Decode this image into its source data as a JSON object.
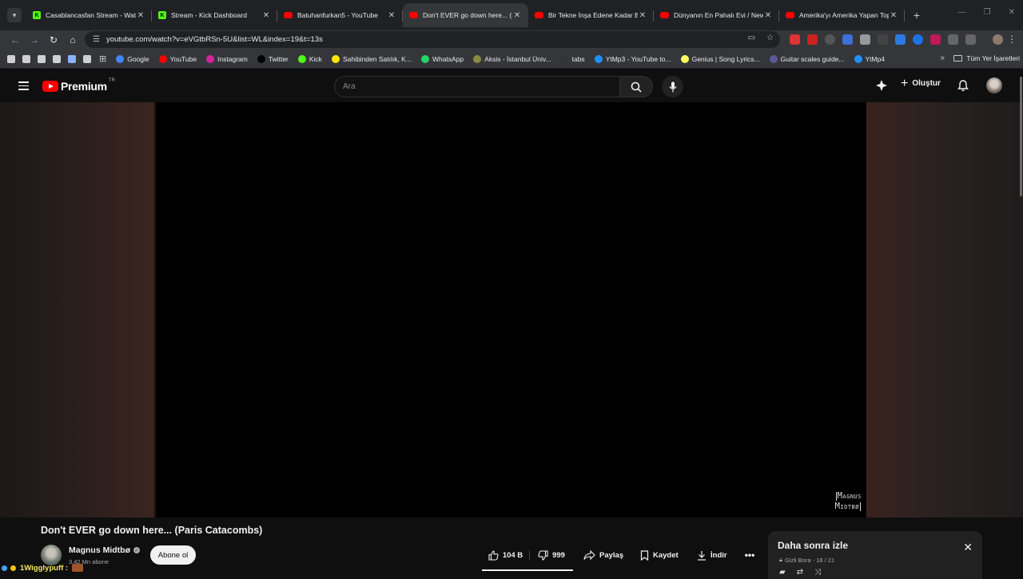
{
  "browser": {
    "tabs": [
      {
        "title": "Casablancasfan Stream - Watch",
        "icon": "kick"
      },
      {
        "title": "Stream - Kick Dashboard",
        "icon": "kick"
      },
      {
        "title": "Batuhanfurkan5 - YouTube",
        "icon": "youtube"
      },
      {
        "title": "Don't EVER go down here... (Pa",
        "icon": "youtube",
        "active": true
      },
      {
        "title": "Bir Tekne İnşa Edene Kadar Bir",
        "icon": "youtube"
      },
      {
        "title": "Dünyanın En Pahalı Evi / New Y",
        "icon": "youtube"
      },
      {
        "title": "Amerika'yı Amerika Yapan Topr",
        "icon": "youtube"
      }
    ],
    "url": "youtube.com/watch?v=eVGtbRSn-5U&list=WL&index=19&t=13s",
    "bookmarks": [
      {
        "label": "Google",
        "color": "#4285f4"
      },
      {
        "label": "YouTube",
        "color": "#ff0000"
      },
      {
        "label": "Instagram",
        "color": "#d6249f"
      },
      {
        "label": "Twitter",
        "color": "#000000"
      },
      {
        "label": "Kick",
        "color": "#53fc18"
      },
      {
        "label": "Sahibinden Satılık, K...",
        "color": "#ffe800"
      },
      {
        "label": "WhatsApp",
        "color": "#25d366"
      },
      {
        "label": "Aksis - İstanbul Üniv...",
        "color": "#8a8a40"
      },
      {
        "label": "tabs",
        "color": "#333333"
      },
      {
        "label": "YtMp3 - YouTube to...",
        "color": "#1e90ff"
      },
      {
        "label": "Genius | Song Lyrics...",
        "color": "#ffff64"
      },
      {
        "label": "Guitar scales guide...",
        "color": "#5a5a9a"
      },
      {
        "label": "YtMp4",
        "color": "#1e90ff"
      }
    ],
    "all_bookmarks_label": "Tüm Yer İşaretleri"
  },
  "youtube": {
    "logo_text": "Premium",
    "logo_region": "TR",
    "search_placeholder": "Ara",
    "create_label": "Oluştur",
    "video": {
      "watermark_line1": "Magnus",
      "watermark_line2": "Midtbø",
      "title": "Don't EVER go down here... (Paris Catacombs)"
    },
    "channel": {
      "name": "Magnus Midtbø",
      "subscribers": "3,42 Mn abone",
      "subscribe_label": "Abone ol"
    },
    "actions": {
      "likes": "104 B",
      "dislikes": "999",
      "share": "Paylaş",
      "save": "Kaydet",
      "download": "İndir"
    },
    "playlist": {
      "title": "Daha sonra izle",
      "subtitle": "Gizli Bora - 18 / 21"
    }
  },
  "overlay": {
    "username": "1Wigglypuff :"
  },
  "colors": {
    "youtube_red": "#ff0000",
    "kick_green": "#53fc18",
    "bg": "#0f0f0f"
  }
}
